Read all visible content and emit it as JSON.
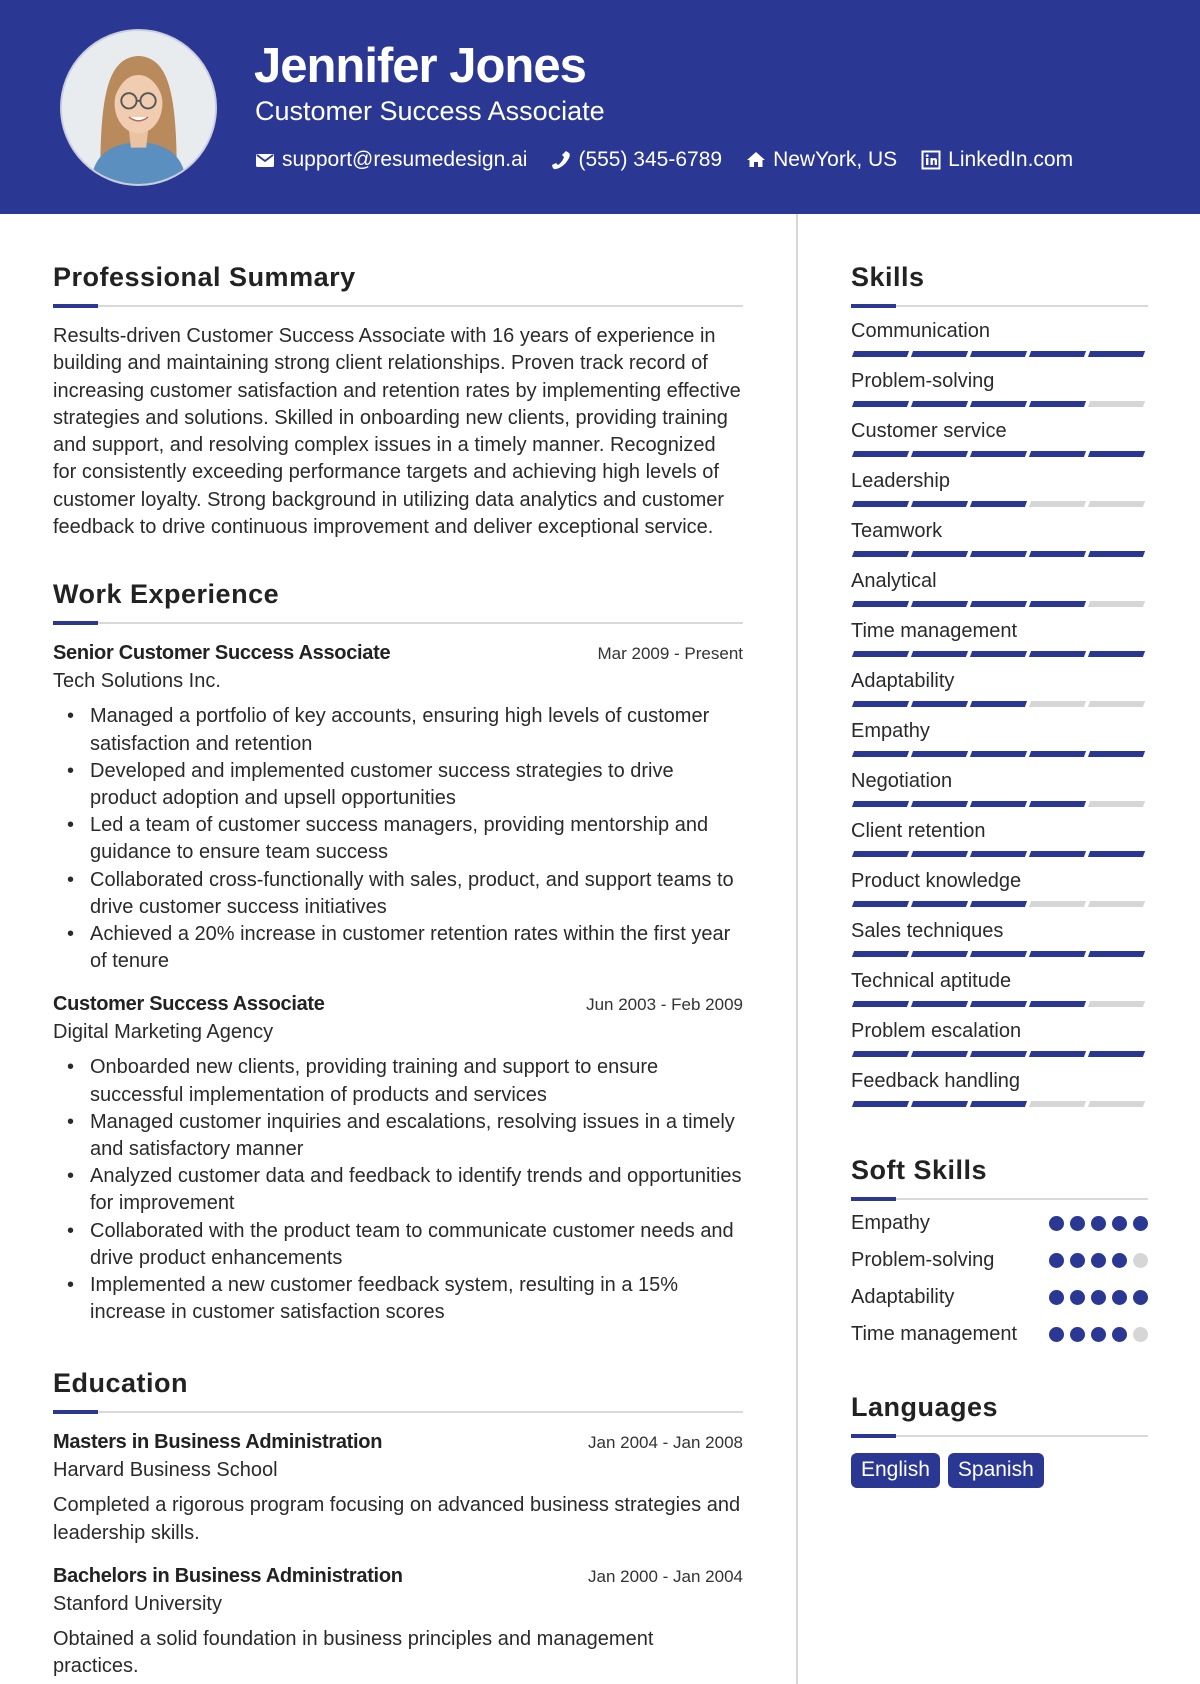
{
  "header": {
    "name": "Jennifer Jones",
    "title": "Customer Success Associate",
    "contacts": [
      {
        "icon": "envelope-icon",
        "text": "support@resumedesign.ai"
      },
      {
        "icon": "phone-icon",
        "text": "(555) 345-6789"
      },
      {
        "icon": "home-icon",
        "text": "NewYork, US"
      },
      {
        "icon": "linkedin-icon",
        "text": "LinkedIn.com"
      }
    ]
  },
  "summary": {
    "heading": "Professional Summary",
    "text": "Results-driven Customer Success Associate with 16 years of experience in building and maintaining strong client relationships. Proven track record of increasing customer satisfaction and retention rates by implementing effective strategies and solutions. Skilled in onboarding new clients, providing training and support, and resolving complex issues in a timely manner. Recognized for consistently exceeding performance targets and achieving high levels of customer loyalty. Strong background in utilizing data analytics and customer feedback to drive continuous improvement and deliver exceptional service."
  },
  "experience": {
    "heading": "Work Experience",
    "jobs": [
      {
        "title": "Senior Customer Success Associate",
        "dates": "Mar 2009 - Present",
        "company": "Tech Solutions Inc.",
        "bullets": [
          "Managed a portfolio of key accounts, ensuring high levels of customer satisfaction and retention",
          "Developed and implemented customer success strategies to drive product adoption and upsell opportunities",
          "Led a team of customer success managers, providing mentorship and guidance to ensure team success",
          "Collaborated cross-functionally with sales, product, and support teams to drive customer success initiatives",
          "Achieved a 20% increase in customer retention rates within the first year of tenure"
        ]
      },
      {
        "title": "Customer Success Associate",
        "dates": "Jun 2003 - Feb 2009",
        "company": "Digital Marketing Agency",
        "bullets": [
          "Onboarded new clients, providing training and support to ensure successful implementation of products and services",
          "Managed customer inquiries and escalations, resolving issues in a timely and satisfactory manner",
          "Analyzed customer data and feedback to identify trends and opportunities for improvement",
          "Collaborated with the product team to communicate customer needs and drive product enhancements",
          "Implemented a new customer feedback system, resulting in a 15% increase in customer satisfaction scores"
        ]
      }
    ]
  },
  "education": {
    "heading": "Education",
    "items": [
      {
        "degree": "Masters in Business Administration",
        "dates": "Jan 2004 - Jan 2008",
        "school": "Harvard Business School",
        "description": "Completed a rigorous program focusing on advanced business strategies and leadership skills."
      },
      {
        "degree": "Bachelors in Business Administration",
        "dates": "Jan 2000 - Jan 2004",
        "school": "Stanford University",
        "description": "Obtained a solid foundation in business principles and management practices."
      }
    ]
  },
  "skills": {
    "heading": "Skills",
    "max_level": 5,
    "items": [
      {
        "name": "Communication",
        "level": 5
      },
      {
        "name": "Problem-solving",
        "level": 4
      },
      {
        "name": "Customer service",
        "level": 5
      },
      {
        "name": "Leadership",
        "level": 3
      },
      {
        "name": "Teamwork",
        "level": 5
      },
      {
        "name": "Analytical",
        "level": 4
      },
      {
        "name": "Time management",
        "level": 5
      },
      {
        "name": "Adaptability",
        "level": 3
      },
      {
        "name": "Empathy",
        "level": 5
      },
      {
        "name": "Negotiation",
        "level": 4
      },
      {
        "name": "Client retention",
        "level": 5
      },
      {
        "name": "Product knowledge",
        "level": 3
      },
      {
        "name": "Sales techniques",
        "level": 5
      },
      {
        "name": "Technical aptitude",
        "level": 4
      },
      {
        "name": "Problem escalation",
        "level": 5
      },
      {
        "name": "Feedback handling",
        "level": 3
      }
    ]
  },
  "soft_skills": {
    "heading": "Soft Skills",
    "max_level": 5,
    "items": [
      {
        "name": "Empathy",
        "level": 5
      },
      {
        "name": "Problem-solving",
        "level": 4
      },
      {
        "name": "Adaptability",
        "level": 5
      },
      {
        "name": "Time management",
        "level": 4
      }
    ]
  },
  "languages": {
    "heading": "Languages",
    "items": [
      "English",
      "Spanish"
    ]
  },
  "colors": {
    "accent": "#2a3893",
    "inactive": "#d6d6d6"
  }
}
